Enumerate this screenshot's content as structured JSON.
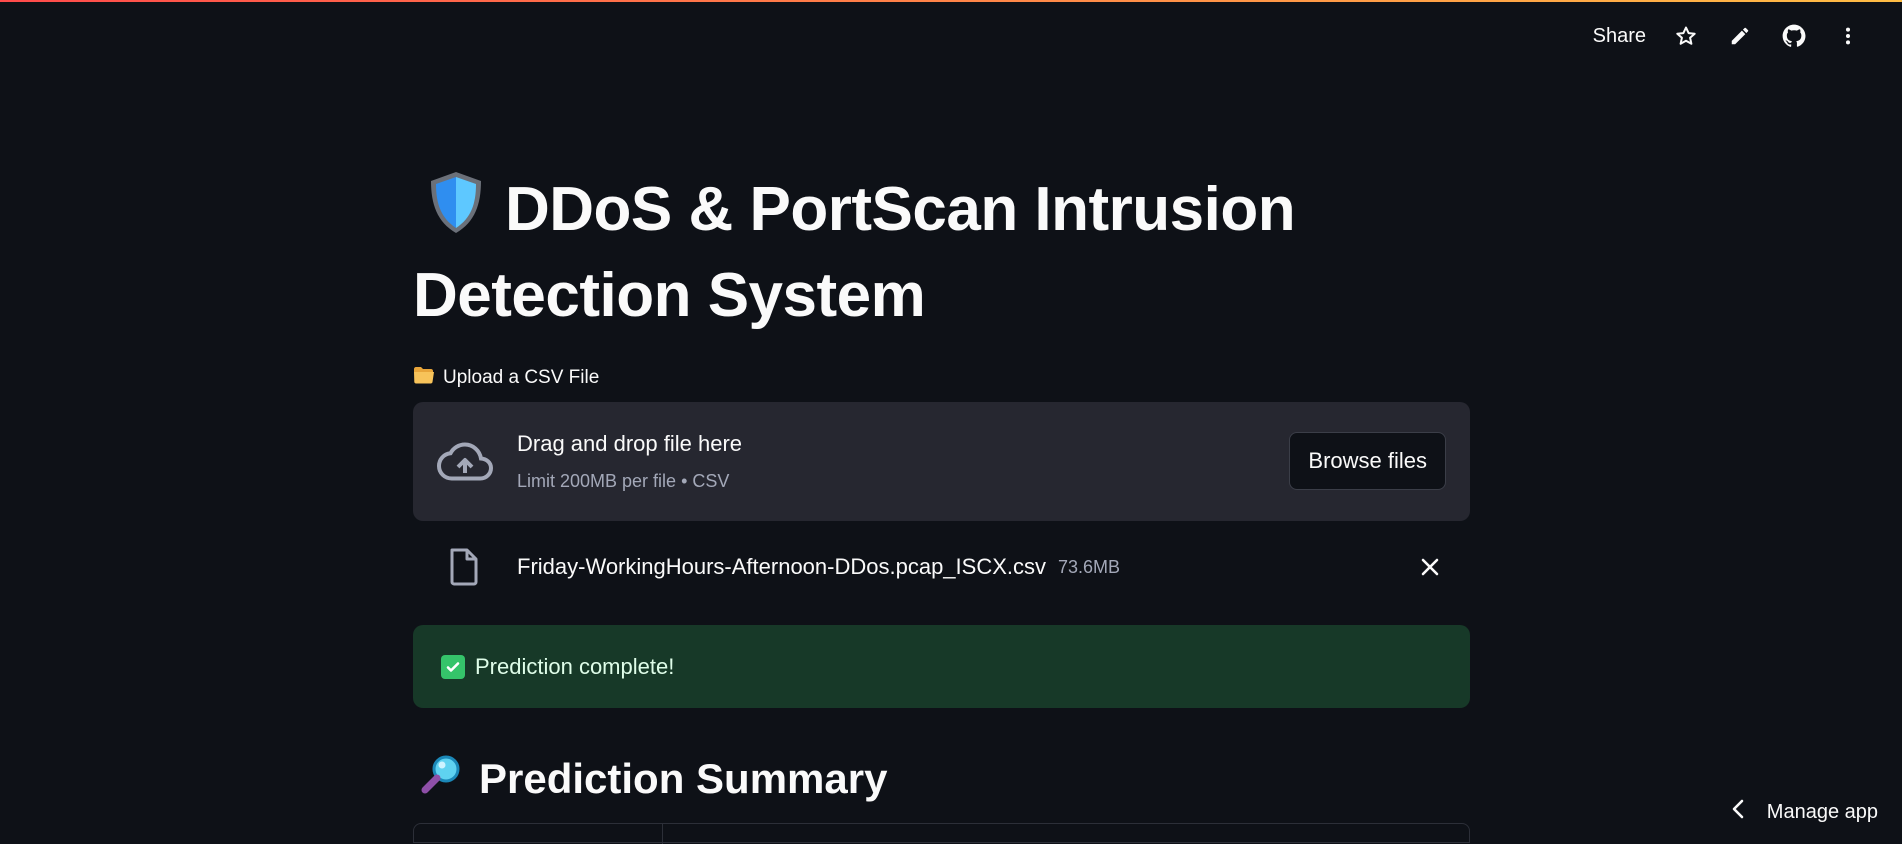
{
  "toolbar": {
    "share_label": "Share",
    "icons": [
      "star-icon",
      "pencil-icon",
      "github-icon",
      "more-vertical-icon"
    ]
  },
  "header": {
    "title": "DDoS & PortScan Intrusion Detection System",
    "title_icon": "shield-icon"
  },
  "uploader": {
    "label": "Upload a CSV File",
    "label_icon": "folder-icon",
    "drop_text": "Drag and drop file here",
    "limit_text": "Limit 200MB per file • CSV",
    "browse_label": "Browse files"
  },
  "file": {
    "name": "Friday-WorkingHours-Afternoon-DDos.pcap_ISCX.csv",
    "size": "73.6MB"
  },
  "alert": {
    "text": "Prediction complete!",
    "icon": "check-box-icon"
  },
  "summary": {
    "heading": "Prediction Summary",
    "icon": "magnifier-icon"
  },
  "footer": {
    "manage_label": "Manage app"
  },
  "colors": {
    "background": "#0e1117",
    "panel": "#262730",
    "success_bg": "#173928",
    "success_accent": "#35c46a"
  }
}
